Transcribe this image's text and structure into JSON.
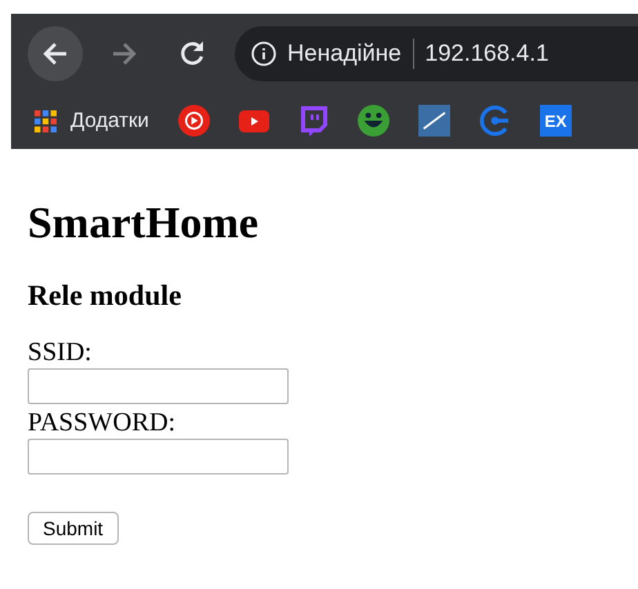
{
  "browser": {
    "security_label": "Ненадійне",
    "address": "192.168.4.1",
    "apps_label": "Додатки",
    "bookmarks": [
      {
        "kind": "music"
      },
      {
        "kind": "video"
      },
      {
        "kind": "stream"
      },
      {
        "kind": "smile"
      },
      {
        "kind": "gauge"
      },
      {
        "kind": "ring"
      },
      {
        "kind": "text",
        "text": "EX"
      }
    ]
  },
  "page": {
    "title": "SmartHome",
    "subtitle": "Rele module",
    "fields": [
      {
        "label": "SSID:"
      },
      {
        "label": "PASSWORD:"
      }
    ],
    "submit": "Submit"
  }
}
